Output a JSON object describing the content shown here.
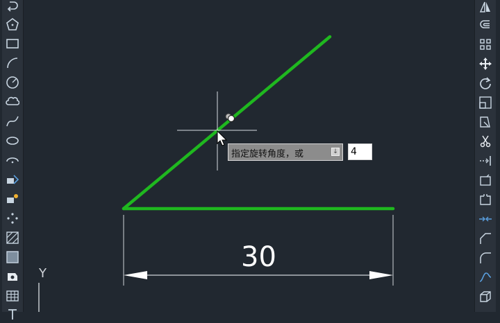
{
  "prompt": {
    "text": "指定旋转角度，或"
  },
  "angle_input": {
    "value": "4"
  },
  "dimension": {
    "text": "30"
  },
  "ucs": {
    "y_label": "Y"
  },
  "colors": {
    "background": "#212830",
    "toolbar": "#2b323b",
    "geometry": "#1fb81f",
    "icon": "#c9d6e2"
  },
  "left_toolbar_icons": [
    "undo-arc-icon",
    "polygon-icon",
    "rectangle-icon",
    "arc-icon",
    "circle-icon",
    "revision-cloud-icon",
    "spline-icon",
    "ellipse-icon",
    "ellipse-arc-icon",
    "insert-block-icon",
    "make-block-icon",
    "point-icon",
    "hatch-icon",
    "gradient-icon",
    "region-icon",
    "table-icon",
    "text-icon"
  ],
  "right_toolbar_icons": [
    "mirror-icon",
    "offset-icon",
    "array-icon",
    "move-icon",
    "rotate-icon",
    "scale-icon",
    "stretch-icon",
    "trim-icon",
    "extend-icon",
    "break-at-point-icon",
    "break-icon",
    "join-icon",
    "chamfer-icon",
    "fillet-icon",
    "blend-curves-icon",
    "explode-icon"
  ]
}
